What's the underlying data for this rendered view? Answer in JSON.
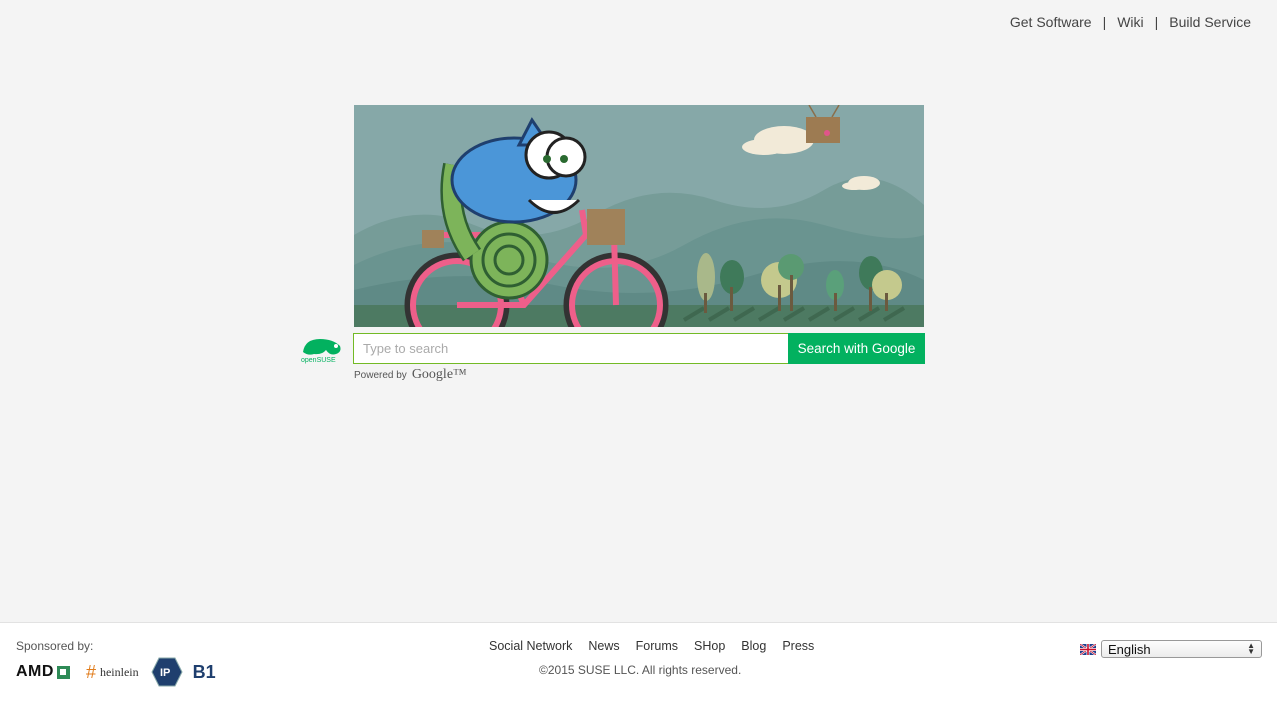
{
  "topnav": {
    "items": [
      "Get Software",
      "Wiki",
      "Build Service"
    ],
    "separator": "|"
  },
  "banner": {
    "image": "chameleon-riding-bicycle-illustration"
  },
  "logo": {
    "text": "openSUSE"
  },
  "search": {
    "placeholder": "Type to search",
    "value": "",
    "button_label": "Search with Google"
  },
  "powered": {
    "label": "Powered by",
    "brand": "Google™"
  },
  "footer": {
    "sponsored_label": "Sponsored by:",
    "sponsors": [
      "AMD",
      "heinlein",
      "IP",
      "B1"
    ],
    "links": [
      "Social Network",
      "News",
      "Forums",
      "SHop",
      "Blog",
      "Press"
    ],
    "copyright": "©2015 SUSE LLC. All rights reserved.",
    "language": "English"
  },
  "colors": {
    "accent": "#02b15f",
    "input_border": "#73ba25",
    "banner_bg": "#86a8a8"
  }
}
